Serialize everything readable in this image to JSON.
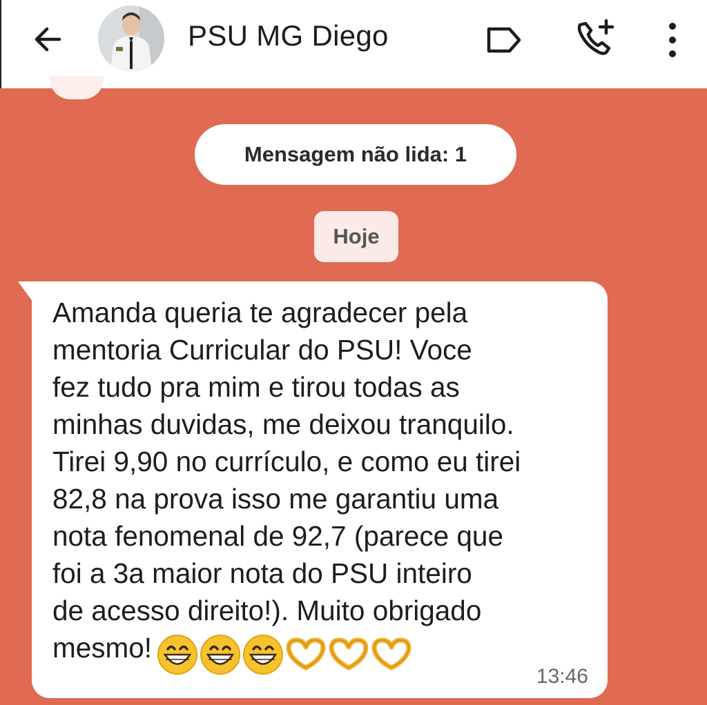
{
  "header": {
    "contact_name": "PSU MG Diego",
    "icons": [
      "back-arrow-icon",
      "label-icon",
      "add-call-icon",
      "more-vert-icon"
    ]
  },
  "chat": {
    "unread_banner": "Mensagem não lida: 1",
    "date_chip": "Hoje",
    "message": {
      "text": "Amanda queria te agradecer pela\nmentoria Curricular do PSU! Voce\nfez tudo pra mim e tirou todas as\nminhas duvidas, me deixou tranquilo.\nTirei 9,90 no currículo, e como eu tirei\n82,8 na prova isso me garantiu uma\nnota fenomenal de 92,7 (parece que\nfoi a 3a maior nota do PSU inteiro\nde acesso direito!). Muito obrigado\nmesmo!",
      "emojis": [
        "grinning-face",
        "grinning-face",
        "grinning-face",
        "heart-hands",
        "heart-hands",
        "heart-hands"
      ],
      "time": "13:46"
    }
  },
  "colors": {
    "chat_background": "#e06a52",
    "bubble": "#ffffff",
    "header": "#ffffff"
  }
}
